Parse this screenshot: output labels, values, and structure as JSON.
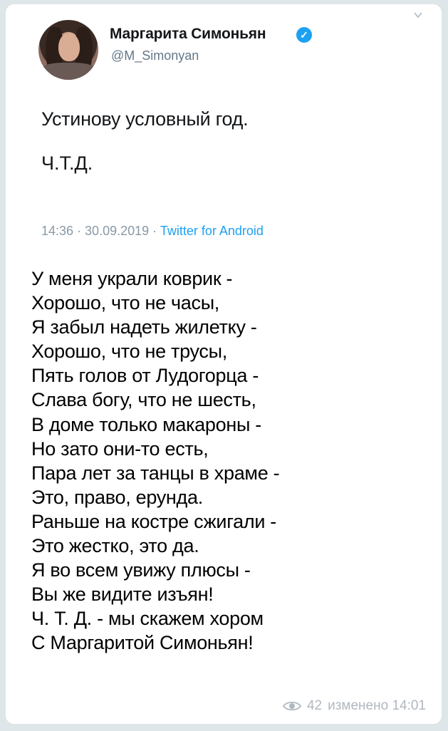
{
  "tweet": {
    "author_name": "Маргарита Симоньян",
    "handle": "@M_Simonyan",
    "verified_mark": "✓",
    "text_line1": "Устинову условный год.",
    "text_line2": "Ч.Т.Д.",
    "time": "14:36",
    "separator1": " · ",
    "date": "30.09.2019",
    "separator2": " · ",
    "source": "Twitter for Android"
  },
  "message": {
    "lines": [
      "У меня украли коврик -",
      "Хорошо, что не часы,",
      "Я забыл надеть жилетку -",
      "Хорошо, что не трусы,",
      "Пять голов от Лудогорца -",
      "Слава богу, что не шесть,",
      "В доме только макароны -",
      "Но зато они-то есть,",
      "Пара лет за танцы в храме -",
      "Это, право, ерунда.",
      "Раньше на костре сжигали -",
      "Это жестко, это да.",
      "Я во всем увижу плюсы -",
      "Вы же видите изъян!",
      "Ч. Т. Д. - мы скажем хором",
      "С Маргаритой Симоньян!"
    ],
    "views": "42",
    "edited_label": "изменено 14:01"
  },
  "colors": {
    "background": "#dfe6ea",
    "bubble": "#ffffff",
    "twitter_blue": "#1da1f2",
    "meta_gray": "#8899a6"
  }
}
